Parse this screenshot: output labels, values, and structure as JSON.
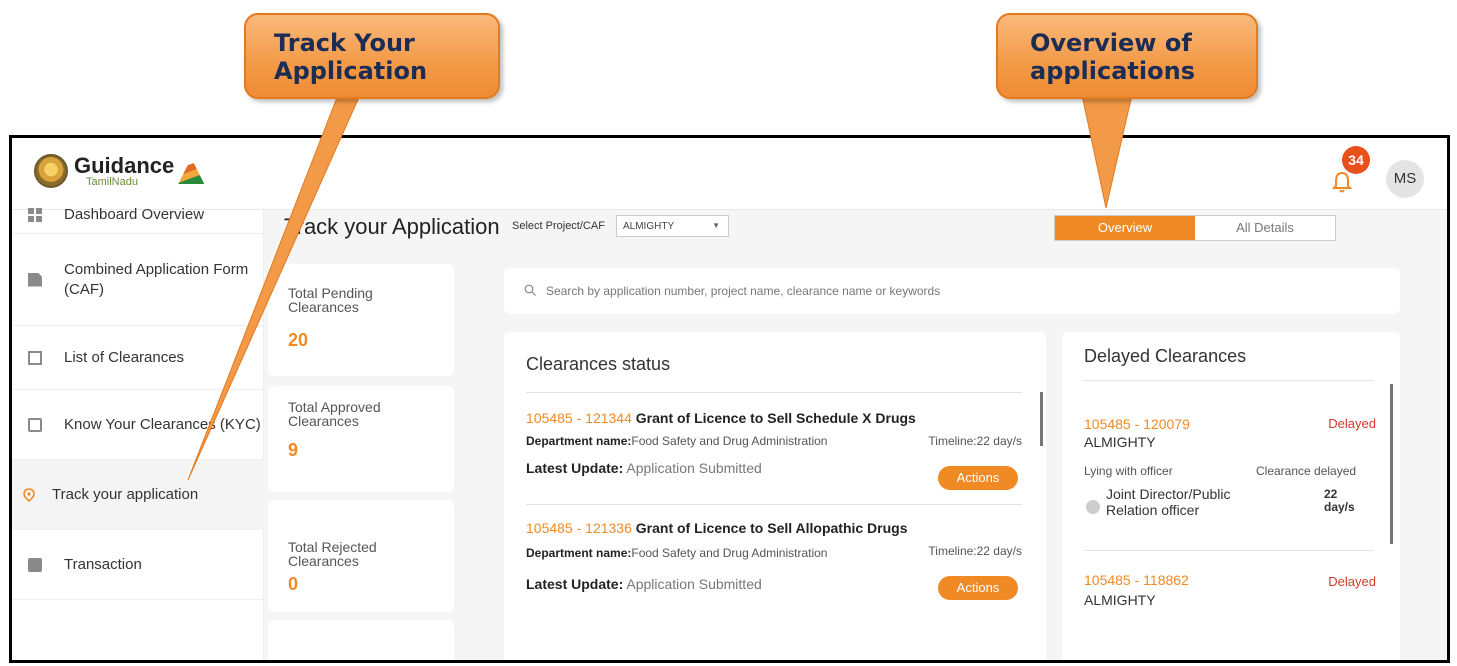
{
  "header": {
    "logo_main": "Guidance",
    "logo_sub": "TamilNadu",
    "notification_count": "34",
    "avatar_initials": "MS"
  },
  "sidebar": {
    "items": [
      {
        "label": "Dashboard Overview",
        "icon": "grid-icon"
      },
      {
        "label": "Combined Application Form (CAF)",
        "icon": "document-icon"
      },
      {
        "label": "List of Clearances",
        "icon": "list-icon"
      },
      {
        "label": "Know Your Clearances (KYC)",
        "icon": "book-icon"
      },
      {
        "label": "Track your application",
        "icon": "location-pin-icon"
      },
      {
        "label": "Transaction",
        "icon": "transaction-icon"
      }
    ]
  },
  "main": {
    "title": "Track your Application",
    "select_label": "Select Project/CAF",
    "select_value": "ALMIGHTY",
    "tabs": [
      "Overview",
      "All Details"
    ],
    "search_placeholder": "Search by application number, project name, clearance name or keywords",
    "stats": [
      {
        "label": "Total Pending Clearances",
        "value": "20"
      },
      {
        "label": "Total Approved Clearances",
        "value": "9"
      },
      {
        "label": "Total Rejected Clearances",
        "value": "0"
      }
    ]
  },
  "clearances_status": {
    "title": "Clearances status",
    "items": [
      {
        "number": "105485 - 121344",
        "name": "Grant of Licence to Sell Schedule X Drugs",
        "dept_label": "Department name:",
        "dept_value": "Food Safety and Drug Administration",
        "timeline": "Timeline:22 day/s",
        "update_label": "Latest Update:",
        "update_value": "Application Submitted",
        "action": "Actions"
      },
      {
        "number": "105485 - 121336",
        "name": "Grant of Licence to Sell Allopathic Drugs",
        "dept_label": "Department name:",
        "dept_value": "Food Safety and Drug Administration",
        "timeline": "Timeline:22 day/s",
        "update_label": "Latest Update:",
        "update_value": "Application Submitted",
        "action": "Actions"
      }
    ]
  },
  "delayed": {
    "title": "Delayed Clearances",
    "items": [
      {
        "number": "105485 - 120079",
        "status": "Delayed",
        "project": "ALMIGHTY",
        "lying_label": "Lying with officer",
        "delay_label": "Clearance delayed",
        "officer": "Joint Director/Public Relation officer",
        "days": "22 day/s"
      },
      {
        "number": "105485 - 118862",
        "status": "Delayed",
        "project": "ALMIGHTY"
      }
    ]
  },
  "callouts": {
    "track": "Track Your Application",
    "overview": "Overview of applications"
  },
  "colors": {
    "accent": "#f08a24",
    "delayed": "#d23a2a",
    "callout": "#f39a48"
  }
}
